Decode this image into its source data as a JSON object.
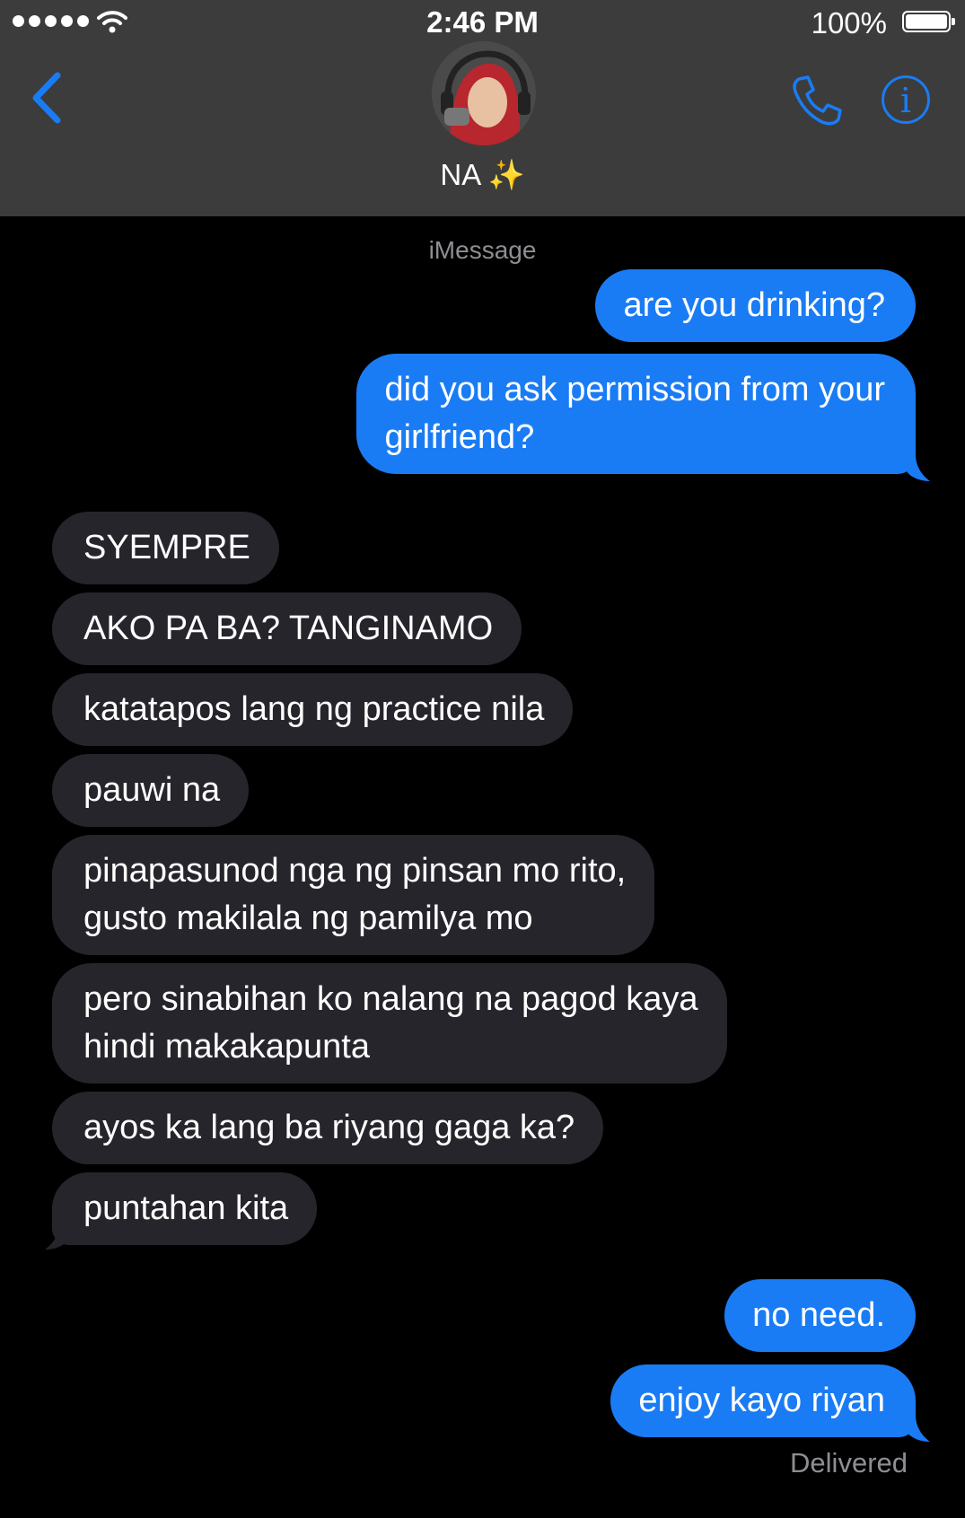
{
  "status_bar": {
    "time": "2:46 PM",
    "battery": "100%",
    "icons": [
      "signal-dots-icon",
      "wifi-icon",
      "battery-icon"
    ]
  },
  "header": {
    "contact_name": "NA ✨",
    "icons": [
      "back-chevron-icon",
      "phone-icon",
      "info-icon"
    ],
    "info_glyph": "i",
    "accent_color": "#1a7cf5"
  },
  "conversation": {
    "service_label": "iMessage",
    "sent_color": "#1a7cf5",
    "received_color": "#26252b",
    "messages": [
      {
        "from": "me",
        "text": "are you drinking?"
      },
      {
        "from": "me",
        "text": "did you ask permission from your\ngirlfriend?"
      },
      {
        "from": "them",
        "text": "SYEMPRE"
      },
      {
        "from": "them",
        "text": "AKO PA BA? TANGINAMO"
      },
      {
        "from": "them",
        "text": "katatapos lang ng practice nila"
      },
      {
        "from": "them",
        "text": "pauwi na"
      },
      {
        "from": "them",
        "text": "pinapasunod nga ng pinsan mo rito,\ngusto makilala ng pamilya mo"
      },
      {
        "from": "them",
        "text": "pero sinabihan ko nalang na pagod kaya\nhindi makakapunta"
      },
      {
        "from": "them",
        "text": "ayos ka lang ba riyang gaga ka?"
      },
      {
        "from": "them",
        "text": "puntahan kita"
      },
      {
        "from": "me",
        "text": "no need."
      },
      {
        "from": "me",
        "text": "enjoy kayo riyan"
      }
    ],
    "delivery_status": "Delivered"
  }
}
